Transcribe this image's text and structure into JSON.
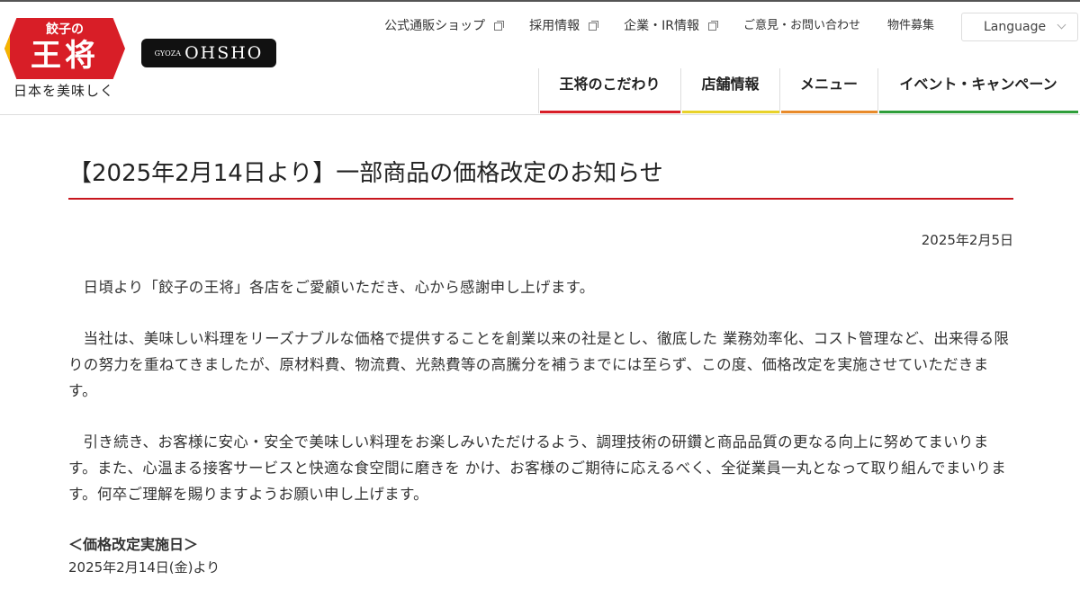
{
  "logo": {
    "badge_top": "餃子の",
    "badge_main": "王将",
    "tagline": "日本を美味しく",
    "brand_small": "GYOZA",
    "brand_big": "OHSHO"
  },
  "util_nav": [
    {
      "label": "公式通販ショップ",
      "external": true
    },
    {
      "label": "採用情報",
      "external": true
    },
    {
      "label": "企業・IR情報",
      "external": true
    },
    {
      "label": "ご意見・お問い合わせ",
      "external": false
    },
    {
      "label": "物件募集",
      "external": false
    }
  ],
  "language": "Language",
  "global_nav": [
    {
      "label": "王将のこだわり",
      "color": "#d81e27"
    },
    {
      "label": "店舗情報",
      "color": "#e8d22a"
    },
    {
      "label": "メニュー",
      "color": "#e88a2a"
    },
    {
      "label": "イベント・キャンペーン",
      "color": "#2e9e3a"
    }
  ],
  "article": {
    "title": "【2025年2月14日より】一部商品の価格改定のお知らせ",
    "date": "2025年2月5日",
    "paragraphs": [
      "日頃より「餃子の王将」各店をご愛顧いただき、心から感謝申し上げます。",
      "当社は、美味しい料理をリーズナブルな価格で提供することを創業以来の社是とし、徹底した 業務効率化、コスト管理など、出来得る限りの努力を重ねてきましたが、原材料費、物流費、光熱費等の高騰分を補うまでには至らず、この度、価格改定を実施させていただきます。",
      "引き続き、お客様に安心・安全で美味しい料理をお楽しみいただけるよう、調理技術の研鑽と商品品質の更なる向上に努めてまいります。また、心温まる接客サービスと快適な食空間に磨きを かけ、お客様のご期待に応えるべく、全従業員一丸となって取り組んでまいります。何卒ご理解を賜りますようお願い申し上げます。"
    ],
    "subheading": "＜価格改定実施日＞",
    "effective_date": "2025年2月14日(金)より"
  }
}
